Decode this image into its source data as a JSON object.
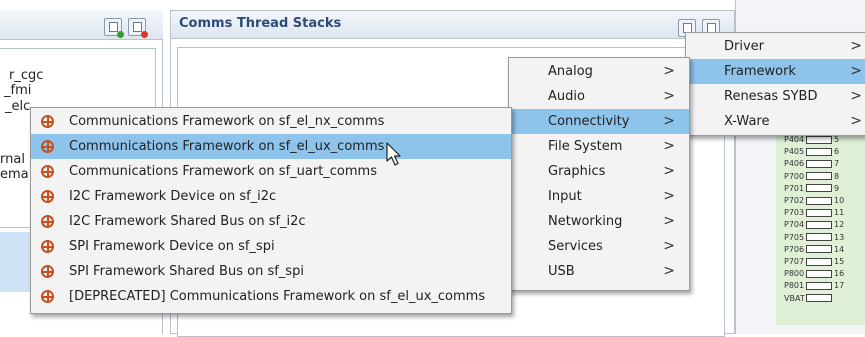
{
  "left_panel": {
    "fragments": [
      "r_cgc",
      "_fmi",
      "_elc",
      "rnal",
      "ema"
    ]
  },
  "stacks_panel": {
    "title": "Comms Thread Stacks"
  },
  "menus": {
    "framework": {
      "items": [
        {
          "label": "Driver",
          "arrow": ">",
          "selected": false
        },
        {
          "label": "Framework",
          "arrow": ">",
          "selected": true
        },
        {
          "label": "Renesas SYBD",
          "arrow": ">",
          "selected": false
        },
        {
          "label": "X-Ware",
          "arrow": ">",
          "selected": false
        }
      ]
    },
    "categories": {
      "items": [
        {
          "label": "Analog",
          "arrow": ">",
          "selected": false
        },
        {
          "label": "Audio",
          "arrow": ">",
          "selected": false
        },
        {
          "label": "Connectivity",
          "arrow": ">",
          "selected": true
        },
        {
          "label": "File System",
          "arrow": ">",
          "selected": false
        },
        {
          "label": "Graphics",
          "arrow": ">",
          "selected": false
        },
        {
          "label": "Input",
          "arrow": ">",
          "selected": false
        },
        {
          "label": "Networking",
          "arrow": ">",
          "selected": false
        },
        {
          "label": "Services",
          "arrow": ">",
          "selected": false
        },
        {
          "label": "USB",
          "arrow": ">",
          "selected": false
        }
      ]
    },
    "stacks": {
      "items": [
        {
          "label": "Communications Framework on sf_el_nx_comms",
          "selected": false
        },
        {
          "label": "Communications Framework on sf_el_ux_comms",
          "selected": true
        },
        {
          "label": "Communications Framework on sf_uart_comms",
          "selected": false
        },
        {
          "label": "I2C Framework Device on sf_i2c",
          "selected": false
        },
        {
          "label": "I2C Framework Shared Bus on sf_i2c",
          "selected": false
        },
        {
          "label": "SPI Framework Device on sf_spi",
          "selected": false
        },
        {
          "label": "SPI Framework Shared Bus on sf_spi",
          "selected": false
        },
        {
          "label": "[DEPRECATED]  Communications Framework on sf_el_ux_comms",
          "selected": false
        }
      ]
    }
  },
  "pins": [
    {
      "label": "P404",
      "num": "5"
    },
    {
      "label": "P405",
      "num": "6"
    },
    {
      "label": "P406",
      "num": "7"
    },
    {
      "label": "P700",
      "num": "8"
    },
    {
      "label": "P701",
      "num": "9"
    },
    {
      "label": "P702",
      "num": "10"
    },
    {
      "label": "P703",
      "num": "11"
    },
    {
      "label": "P704",
      "num": "12"
    },
    {
      "label": "P705",
      "num": "13"
    },
    {
      "label": "P706",
      "num": "14"
    },
    {
      "label": "P707",
      "num": "15"
    },
    {
      "label": "P800",
      "num": "16"
    },
    {
      "label": "P801",
      "num": "17"
    },
    {
      "label": "VBAT",
      "num": ""
    }
  ],
  "colors": {
    "selection": "#8ec3eb",
    "menu_bg": "#f3f3f3",
    "stack_icon": "#c5521e",
    "title_text": "#2c4c78"
  },
  "icons": {
    "stack_item": "component-crosshair-icon",
    "left_add": "add-element-icon",
    "left_remove": "remove-element-icon",
    "stacks_add": "add-stack-icon",
    "stacks_remove": "remove-stack-icon"
  }
}
